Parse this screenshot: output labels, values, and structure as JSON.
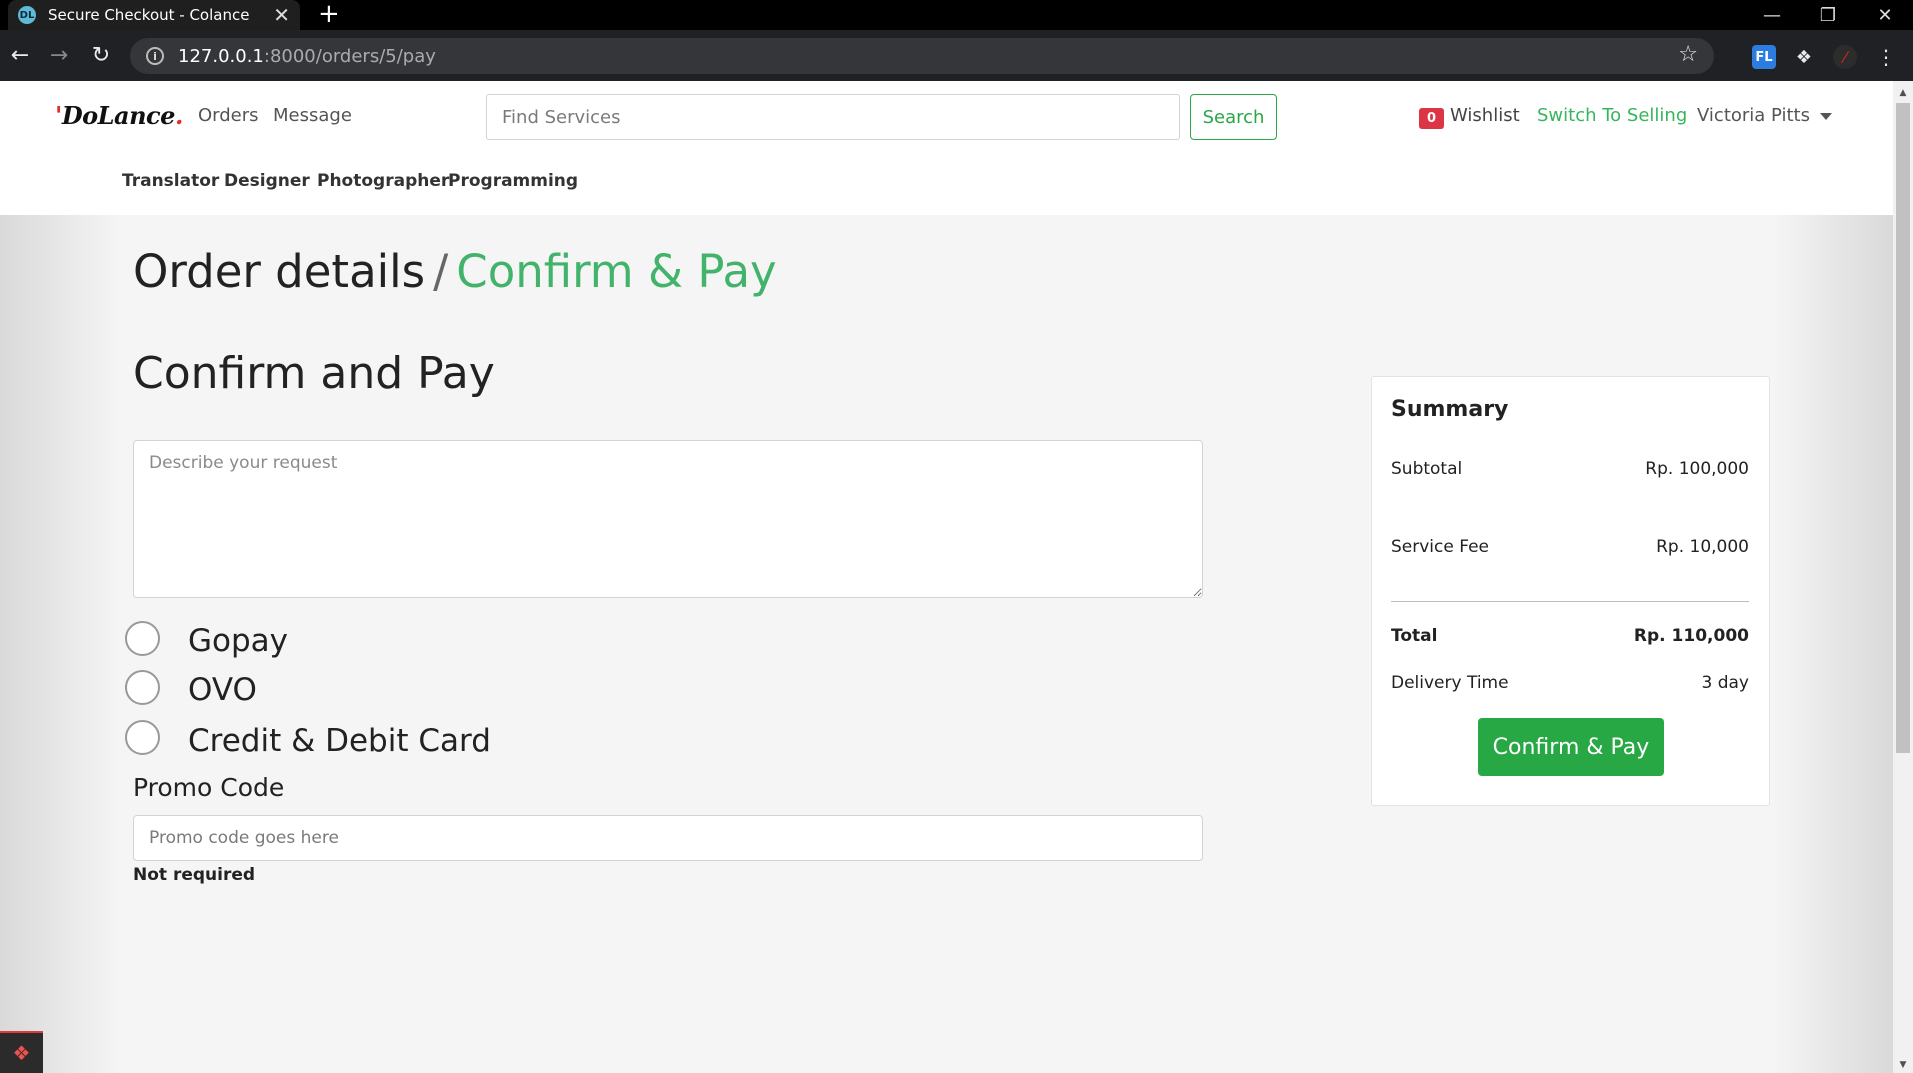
{
  "browser": {
    "tab_title": "Secure Checkout - Colance",
    "favicon_text": "DL",
    "tab_close": "✕",
    "new_tab": "+",
    "url_host": "127.0.0.1",
    "url_path": ":8000/orders/5/pay",
    "ext_fl": "FL",
    "controls": {
      "minimize": "—",
      "maximize": "❐",
      "close": "✕"
    }
  },
  "header": {
    "logo": "DoLance",
    "nav": [
      "Orders",
      "Message"
    ],
    "search_placeholder": "Find Services",
    "search_button": "Search",
    "wishlist_count": "0",
    "wishlist_label": "Wishlist",
    "switch_label": "Switch To Selling",
    "user_name": "Victoria Pitts"
  },
  "categories": [
    "Translator",
    "Designer",
    "Photographer",
    "Programming"
  ],
  "breadcrumb": {
    "parent": "Order details",
    "separator": "/",
    "current": "Confirm & Pay"
  },
  "form": {
    "title": "Confirm and Pay",
    "request_placeholder": "Describe your request",
    "payment_options": [
      "Gopay",
      "OVO",
      "Credit & Debit Card"
    ],
    "promo_label": "Promo Code",
    "promo_placeholder": "Promo code goes here",
    "promo_help": "Not required"
  },
  "summary": {
    "title": "Summary",
    "subtotal_label": "Subtotal",
    "subtotal_value": "Rp. 100,000",
    "fee_label": "Service Fee",
    "fee_value": "Rp. 10,000",
    "total_label": "Total",
    "total_value": "Rp. 110,000",
    "delivery_label": "Delivery Time",
    "delivery_value": "3 day",
    "confirm_button": "Confirm & Pay"
  },
  "colors": {
    "accent": "#28a745",
    "badge": "#dc3545"
  }
}
